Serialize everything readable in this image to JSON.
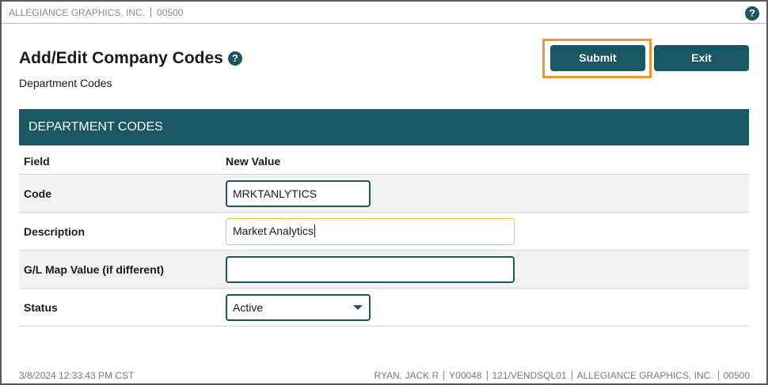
{
  "topbar": {
    "company_name": "ALLEGIANCE GRAPHICS, INC.",
    "company_code": "00500",
    "help_glyph": "?"
  },
  "page": {
    "title": "Add/Edit Company Codes",
    "title_help_glyph": "?",
    "subtitle": "Department Codes"
  },
  "actions": {
    "submit_label": "Submit",
    "exit_label": "Exit"
  },
  "panel": {
    "header": "DEPARTMENT CODES",
    "col_field": "Field",
    "col_new_value": "New Value",
    "rows": [
      {
        "label": "Code",
        "value": "MRKTANLYTICS"
      },
      {
        "label": "Description",
        "value": "Market Analytics"
      },
      {
        "label": "G/L Map Value (if different)",
        "value": ""
      },
      {
        "label": "Status",
        "value": "Active"
      }
    ]
  },
  "footer": {
    "timestamp": "3/8/2024 12:33:43 PM CST",
    "user": "RYAN, JACK R",
    "user_id": "Y00048",
    "server": "121/VENDSQL01",
    "company_name": "ALLEGIANCE GRAPHICS, INC.",
    "company_code": "00500"
  },
  "colors": {
    "brand": "#1b5664",
    "highlight": "#f0962e",
    "focus_border": "#e8c84a"
  },
  "icons": {
    "help": "help-icon",
    "dropdown": "chevron-down-icon"
  }
}
